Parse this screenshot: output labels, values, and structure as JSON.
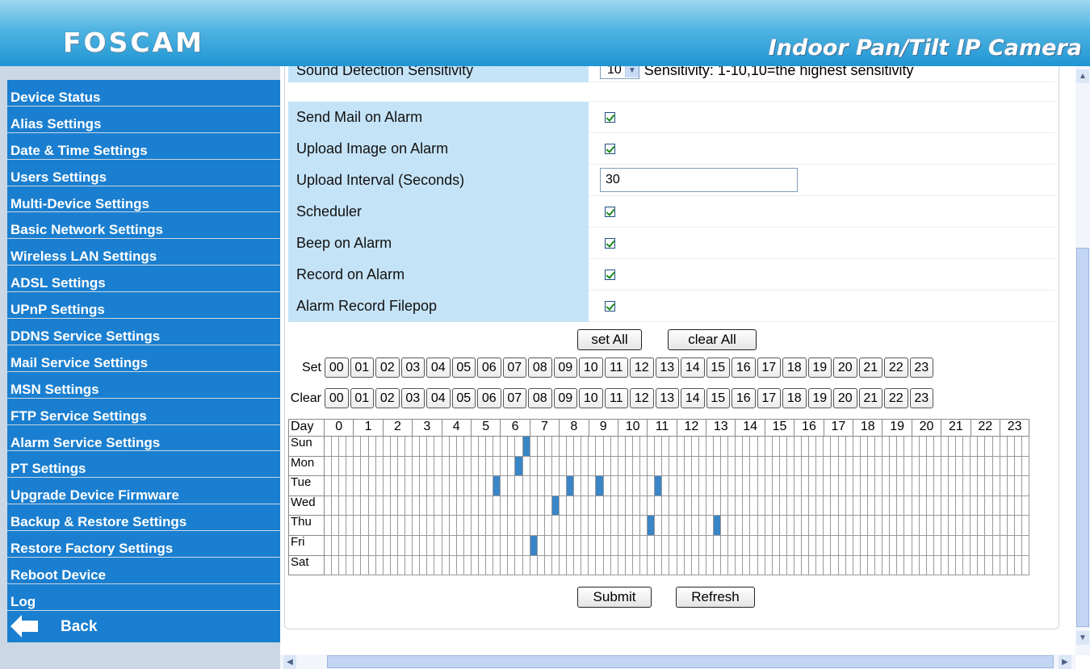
{
  "header": {
    "logo": "FOSCAM",
    "product": "Indoor Pan/Tilt IP Camera"
  },
  "sidebar": {
    "items": [
      "Device Status",
      "Alias Settings",
      "Date & Time Settings",
      "Users Settings",
      "Multi-Device Settings",
      "Basic Network Settings",
      "Wireless LAN Settings",
      "ADSL Settings",
      "UPnP Settings",
      "DDNS Service Settings",
      "Mail Service Settings",
      "MSN Settings",
      "FTP Service Settings",
      "Alarm Service Settings",
      "PT Settings",
      "Upgrade Device Firmware",
      "Backup & Restore Settings",
      "Restore Factory Settings",
      "Reboot Device",
      "Log"
    ],
    "back_label": "Back"
  },
  "form": {
    "sound_sensitivity_label": "Sound Detection Sensitivity",
    "sound_sensitivity_value": "10",
    "sound_sensitivity_hint": "Sensitivity: 1-10,10=the highest sensitivity",
    "send_mail_label": "Send Mail on Alarm",
    "send_mail_checked": true,
    "upload_image_label": "Upload Image on Alarm",
    "upload_image_checked": true,
    "upload_interval_label": "Upload Interval (Seconds)",
    "upload_interval_value": "30",
    "scheduler_label": "Scheduler",
    "scheduler_checked": true,
    "beep_label": "Beep on Alarm",
    "beep_checked": true,
    "record_label": "Record on Alarm",
    "record_checked": true,
    "filepop_label": "Alarm Record Filepop",
    "filepop_checked": true
  },
  "buttons": {
    "set_all": "set All",
    "clear_all": "clear All",
    "submit": "Submit",
    "refresh": "Refresh"
  },
  "schedule": {
    "set_label": "Set",
    "clear_label": "Clear",
    "day_label": "Day",
    "hour_buttons": [
      "00",
      "01",
      "02",
      "03",
      "04",
      "05",
      "06",
      "07",
      "08",
      "09",
      "10",
      "11",
      "12",
      "13",
      "14",
      "15",
      "16",
      "17",
      "18",
      "19",
      "20",
      "21",
      "22",
      "23"
    ],
    "hours": [
      "0",
      "1",
      "2",
      "3",
      "4",
      "5",
      "6",
      "7",
      "8",
      "9",
      "10",
      "11",
      "12",
      "13",
      "14",
      "15",
      "16",
      "17",
      "18",
      "19",
      "20",
      "21",
      "22",
      "23"
    ],
    "days": [
      "Sun",
      "Mon",
      "Tue",
      "Wed",
      "Thu",
      "Fri",
      "Sat"
    ],
    "active_slots": {
      "Sun": [
        27
      ],
      "Mon": [
        26
      ],
      "Tue": [
        23,
        33,
        37,
        45
      ],
      "Wed": [
        31
      ],
      "Thu": [
        44,
        53
      ],
      "Fri": [
        28
      ],
      "Sat": []
    }
  }
}
